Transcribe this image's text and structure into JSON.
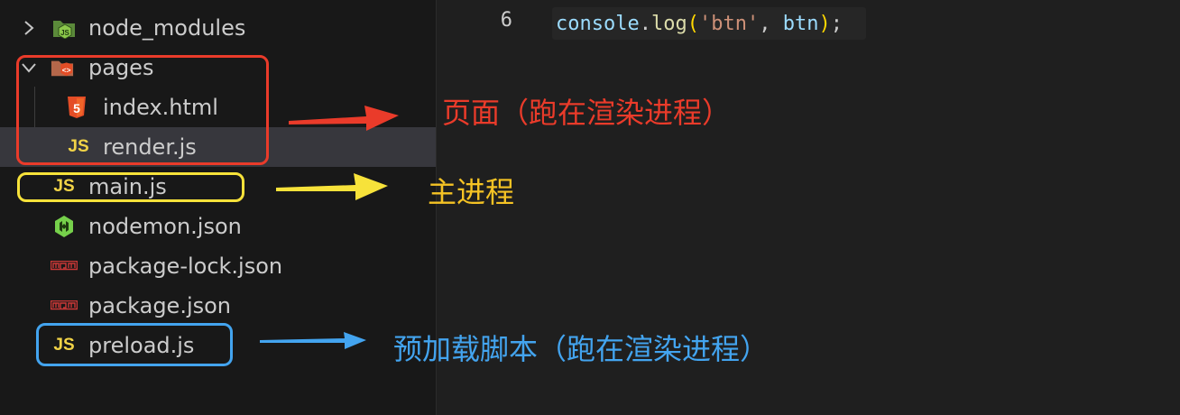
{
  "explorer": {
    "items": [
      {
        "label": "node_modules",
        "icon": "node-modules-folder-icon",
        "twisty": "chevron-right-icon"
      },
      {
        "label": "pages",
        "icon": "pages-folder-icon",
        "twisty": "chevron-down-icon"
      },
      {
        "label": "index.html",
        "icon": "html5-icon"
      },
      {
        "label": "render.js",
        "icon": "js-file-icon",
        "icon_text": "JS",
        "selected": true
      },
      {
        "label": "main.js",
        "icon": "js-file-icon",
        "icon_text": "JS"
      },
      {
        "label": "nodemon.json",
        "icon": "nodemon-icon"
      },
      {
        "label": "package-lock.json",
        "icon": "npm-icon"
      },
      {
        "label": "package.json",
        "icon": "npm-icon"
      },
      {
        "label": "preload.js",
        "icon": "js-file-icon",
        "icon_text": "JS"
      }
    ]
  },
  "editor": {
    "line_number": "6",
    "code": {
      "object": "console",
      "dot": ".",
      "method": "log",
      "open_paren": "(",
      "string": "'btn'",
      "comma": ", ",
      "arg": "btn",
      "close_paren": ")",
      "semicolon": ";"
    }
  },
  "annotations": {
    "renderer_page": "页面（跑在渲染进程）",
    "main_process": "主进程",
    "preload_script": "预加载脚本（跑在渲染进程）"
  },
  "colors": {
    "red": "#ea3b2a",
    "yellow": "#f7e23a",
    "blue": "#43a4ef",
    "js_icon": "#f1d347",
    "selected_row": "#37373d"
  }
}
